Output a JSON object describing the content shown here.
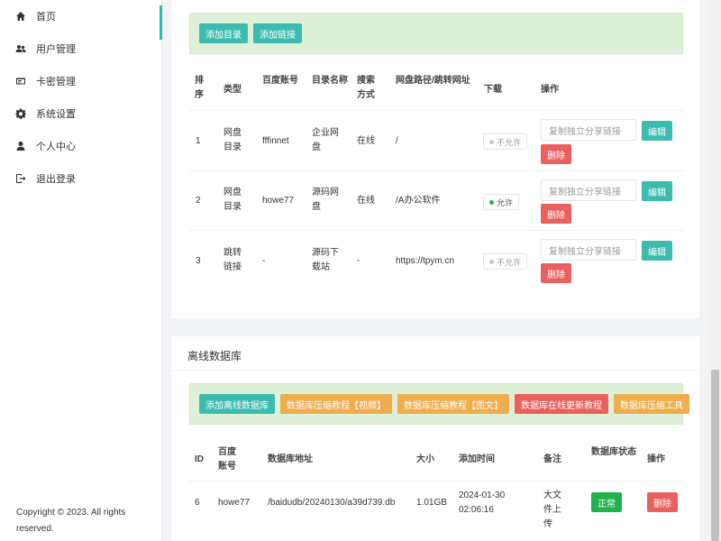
{
  "sidebar": {
    "items": [
      {
        "label": "首页",
        "icon": "home-icon"
      },
      {
        "label": "用户管理",
        "icon": "users-icon"
      },
      {
        "label": "卡密管理",
        "icon": "card-icon"
      },
      {
        "label": "系统设置",
        "icon": "gear-icon"
      },
      {
        "label": "个人中心",
        "icon": "user-icon"
      },
      {
        "label": "退出登录",
        "icon": "logout-icon"
      }
    ],
    "copyright": "Copyright © 2023. All rights reserved."
  },
  "directories": {
    "toolbar": {
      "add_directory": "添加目录",
      "add_link": "添加链接"
    },
    "headers": {
      "sort": "排序",
      "type": "类型",
      "baidu_account": "百度账号",
      "dir_name": "目录名称",
      "search_mode": "搜索方式",
      "path": "网盘路径/跳转网址",
      "download": "下载",
      "actions": "操作"
    },
    "rows": [
      {
        "sort": "1",
        "type": "网盘目录",
        "account": "fffinnet",
        "name": "企业网盘",
        "mode": "在线",
        "path": "/",
        "download": "不允许",
        "download_on": false,
        "share_placeholder": "复制独立分享链接",
        "edit": "编辑",
        "delete": "删除"
      },
      {
        "sort": "2",
        "type": "网盘目录",
        "account": "howe77",
        "name": "源码网盘",
        "mode": "在线",
        "path": "/A办公软件",
        "download": "允许",
        "download_on": true,
        "share_placeholder": "复制独立分享链接",
        "edit": "编辑",
        "delete": "删除"
      },
      {
        "sort": "3",
        "type": "跳转链接",
        "account": "-",
        "name": "源码下载站",
        "mode": "-",
        "path": "https://tpym.cn",
        "download": "不允许",
        "download_on": false,
        "share_placeholder": "复制独立分享链接",
        "edit": "编辑",
        "delete": "删除"
      }
    ]
  },
  "offline_db": {
    "title": "离线数据库",
    "toolbar": {
      "add_db": "添加离线数据库",
      "compress_video": "数据库压缩教程【视频】",
      "compress_text": "数据库压缩教程【图文】",
      "online_update": "数据库在线更新教程",
      "compress_tool": "数据库压缩工具"
    },
    "headers": {
      "id": "ID",
      "baidu_account": "百度账号",
      "db_path": "数据库地址",
      "size": "大小",
      "added_time": "添加时间",
      "note": "备注",
      "status": "数据库状态",
      "actions": "操作"
    },
    "rows": [
      {
        "id": "6",
        "account": "howe77",
        "path": "/baidudb/20240130/a39d739.db",
        "size": "1.01GB",
        "date": "2024-01-30",
        "time": "02:06:16",
        "note": "大文件上传",
        "status": "正常",
        "delete": "删除"
      }
    ]
  },
  "colors": {
    "accent": "#2bbbad",
    "teal": "#3cbcb0",
    "orange": "#f0ad4e",
    "red": "#e9605e",
    "green": "#22b14c"
  }
}
